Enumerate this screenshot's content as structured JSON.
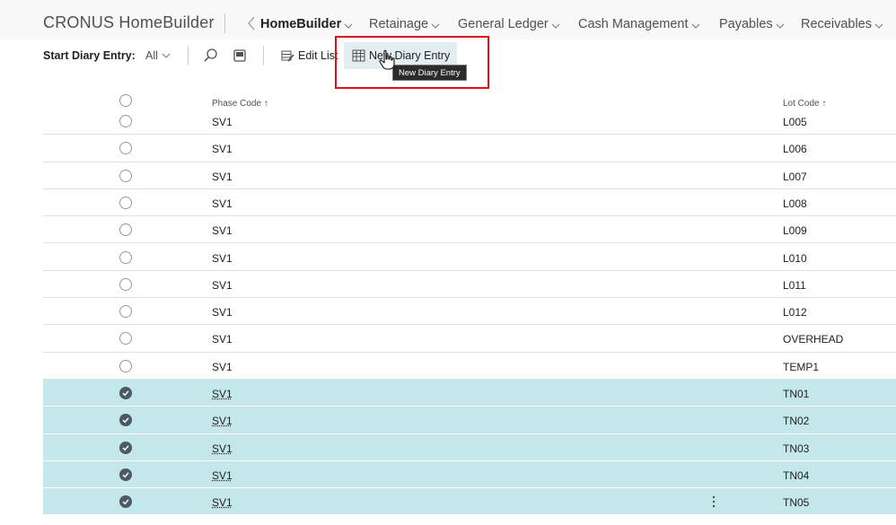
{
  "app": {
    "title": "CRONUS HomeBuilder"
  },
  "nav": {
    "items": [
      {
        "label": "HomeBuilder",
        "active": true
      },
      {
        "label": "Retainage"
      },
      {
        "label": "General Ledger"
      },
      {
        "label": "Cash Management"
      },
      {
        "label": "Payables"
      },
      {
        "label": "Receivables"
      }
    ]
  },
  "actions": {
    "start_label": "Start Diary Entry:",
    "filter_value": "All",
    "edit_list": "Edit List",
    "new_diary_entry": "New Diary Entry",
    "tooltip": "New Diary Entry",
    "icons": [
      "search-icon",
      "filter-pane-icon",
      "edit-list-icon",
      "new-entry-icon"
    ]
  },
  "grid": {
    "columns": {
      "phase": "Phase Code ↑",
      "lot": "Lot Code ↑"
    },
    "rows": [
      {
        "phase": "SV1",
        "lot": "L005",
        "selected": false
      },
      {
        "phase": "SV1",
        "lot": "L006",
        "selected": false
      },
      {
        "phase": "SV1",
        "lot": "L007",
        "selected": false
      },
      {
        "phase": "SV1",
        "lot": "L008",
        "selected": false
      },
      {
        "phase": "SV1",
        "lot": "L009",
        "selected": false
      },
      {
        "phase": "SV1",
        "lot": "L010",
        "selected": false
      },
      {
        "phase": "SV1",
        "lot": "L011",
        "selected": false
      },
      {
        "phase": "SV1",
        "lot": "L012",
        "selected": false
      },
      {
        "phase": "SV1",
        "lot": "OVERHEAD",
        "selected": false
      },
      {
        "phase": "SV1",
        "lot": "TEMP1",
        "selected": false
      },
      {
        "phase": "SV1",
        "lot": "TN01",
        "selected": true
      },
      {
        "phase": "SV1",
        "lot": "TN02",
        "selected": true
      },
      {
        "phase": "SV1",
        "lot": "TN03",
        "selected": true
      },
      {
        "phase": "SV1",
        "lot": "TN04",
        "selected": true
      },
      {
        "phase": "SV1",
        "lot": "TN05",
        "selected": true
      }
    ]
  },
  "colors": {
    "selected_row": "#c4e7eb",
    "highlight": "#e0101a",
    "accent": "#4a5b66"
  }
}
